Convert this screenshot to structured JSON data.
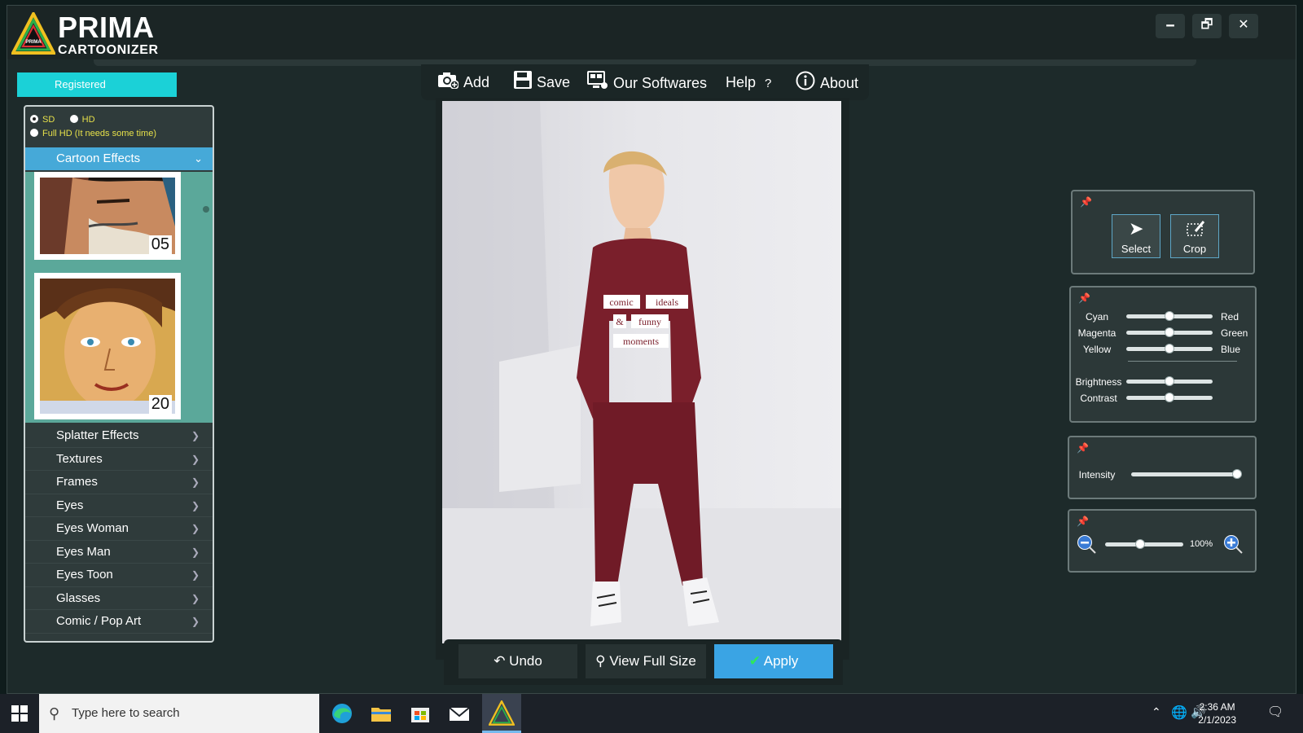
{
  "app": {
    "logo_line1": "PRIMA",
    "logo_line2": "CARTOONIZER",
    "logo_badge": "PRIMA",
    "status": "Registered",
    "window_controls": {
      "minimize": "🗕",
      "restore": "🗗",
      "close": "✕"
    }
  },
  "toolbar": {
    "add": "Add",
    "save": "Save",
    "softwares": "Our Softwares",
    "help": "Help",
    "help_mark": "?",
    "about": "About"
  },
  "sidebar": {
    "resolution": {
      "sd": "SD",
      "hd": "HD",
      "fullhd": "Full HD (It needs some time)",
      "selected": "SD"
    },
    "active_category": "Cartoon Effects",
    "thumbs": [
      {
        "number": "05"
      },
      {
        "number": "20"
      }
    ],
    "categories": [
      "Splatter Effects",
      "Textures",
      "Frames",
      "Eyes",
      "Eyes Woman",
      "Eyes Man",
      "Eyes Toon",
      "Glasses",
      "Comic / Pop Art"
    ]
  },
  "photo": {
    "shirt_words": [
      "comic",
      "ideals",
      "&",
      "funny",
      "moments"
    ]
  },
  "bottom": {
    "undo": "Undo",
    "view_full": "View Full Size",
    "apply": "Apply"
  },
  "tools": {
    "select": "Select",
    "crop": "Crop"
  },
  "color_panel": {
    "rows": [
      {
        "left": "Cyan",
        "right": "Red",
        "value": 0.5
      },
      {
        "left": "Magenta",
        "right": "Green",
        "value": 0.5
      },
      {
        "left": "Yellow",
        "right": "Blue",
        "value": 0.5
      }
    ],
    "tone_rows": [
      {
        "label": "Brightness",
        "value": 0.5
      },
      {
        "label": "Contrast",
        "value": 0.5
      }
    ]
  },
  "intensity": {
    "label": "Intensity",
    "value": 1.0
  },
  "zoom": {
    "label": "100%",
    "value": 0.45
  },
  "taskbar": {
    "search_placeholder": "Type here to search",
    "time": "2:36 AM",
    "date": "2/1/2023"
  },
  "colors": {
    "accent_cyan": "#1bd1d7",
    "accent_blue": "#46a9d8",
    "apply_blue": "#3aa4e4",
    "gallery_teal": "#5ba89a",
    "sweater": "#7a1f2b"
  }
}
